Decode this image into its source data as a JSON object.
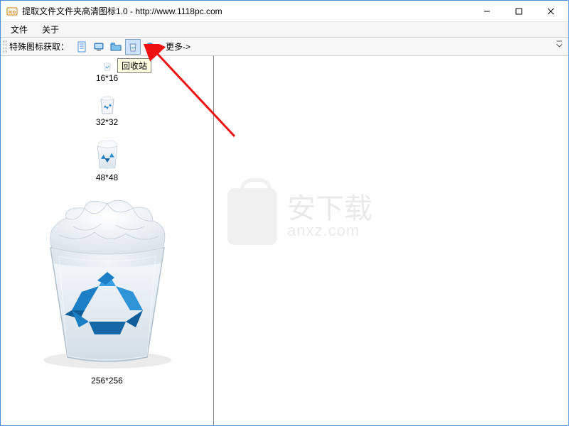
{
  "window": {
    "title": "提取文件文件夹高清图标1.0 - http://www.1118pc.com"
  },
  "menu": {
    "file": "文件",
    "about": "关于"
  },
  "toolbar": {
    "label": "特殊图标获取：",
    "more": "更多->"
  },
  "tooltip": "回收站",
  "icons": {
    "size16": "16*16",
    "size32": "32*32",
    "size48": "48*48",
    "size256": "256*256"
  },
  "watermark": {
    "cn": "安下载",
    "en": "anxz.com"
  }
}
